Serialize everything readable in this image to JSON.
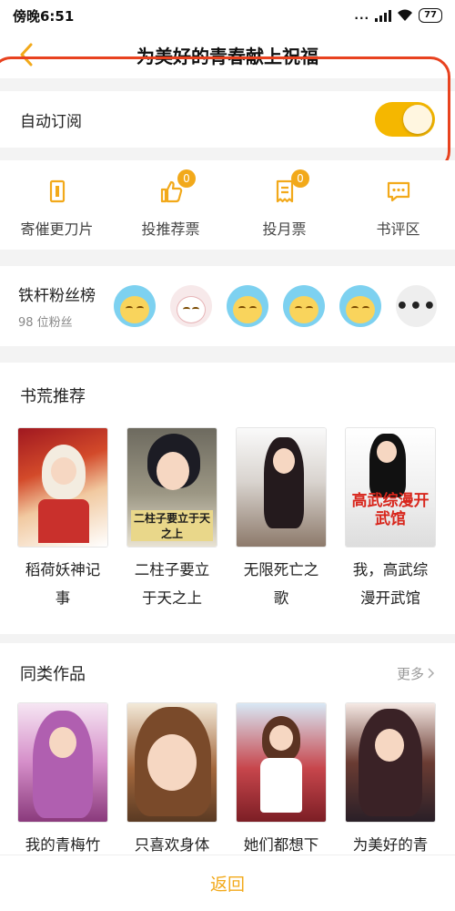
{
  "status_bar": {
    "time": "傍晚6:51",
    "dots": "...",
    "battery": "77"
  },
  "header": {
    "title": "为美好的青春献上祝福"
  },
  "auto_subscribe": {
    "label": "自动订阅",
    "enabled": true
  },
  "actions": [
    {
      "label": "寄催更刀片",
      "icon": "blade-icon",
      "badge": ""
    },
    {
      "label": "投推荐票",
      "icon": "thumbs-up-icon",
      "badge": "0"
    },
    {
      "label": "投月票",
      "icon": "ticket-icon",
      "badge": "0"
    },
    {
      "label": "书评区",
      "icon": "comment-icon",
      "badge": ""
    }
  ],
  "fans": {
    "title": "铁杆粉丝榜",
    "count": "98 位粉丝"
  },
  "recommend": {
    "title": "书荒推荐",
    "books": [
      {
        "name": "稻荷妖神记事",
        "cover_text": ""
      },
      {
        "name": "二柱子要立于天之上",
        "cover_text": "二柱子要立于天之上"
      },
      {
        "name": "无限死亡之歌",
        "cover_text": ""
      },
      {
        "name": "我，高武综漫开武馆",
        "cover_text": "高武综漫开武馆"
      }
    ]
  },
  "similar": {
    "title": "同类作品",
    "more": "更多",
    "books": [
      {
        "name": "我的青梅竹"
      },
      {
        "name": "只喜欢身体"
      },
      {
        "name": "她们都想下"
      },
      {
        "name": "为美好的青"
      }
    ]
  },
  "bottom": {
    "back_label": "返回"
  },
  "colors": {
    "accent": "#f2a91a",
    "highlight": "#e8421f"
  }
}
